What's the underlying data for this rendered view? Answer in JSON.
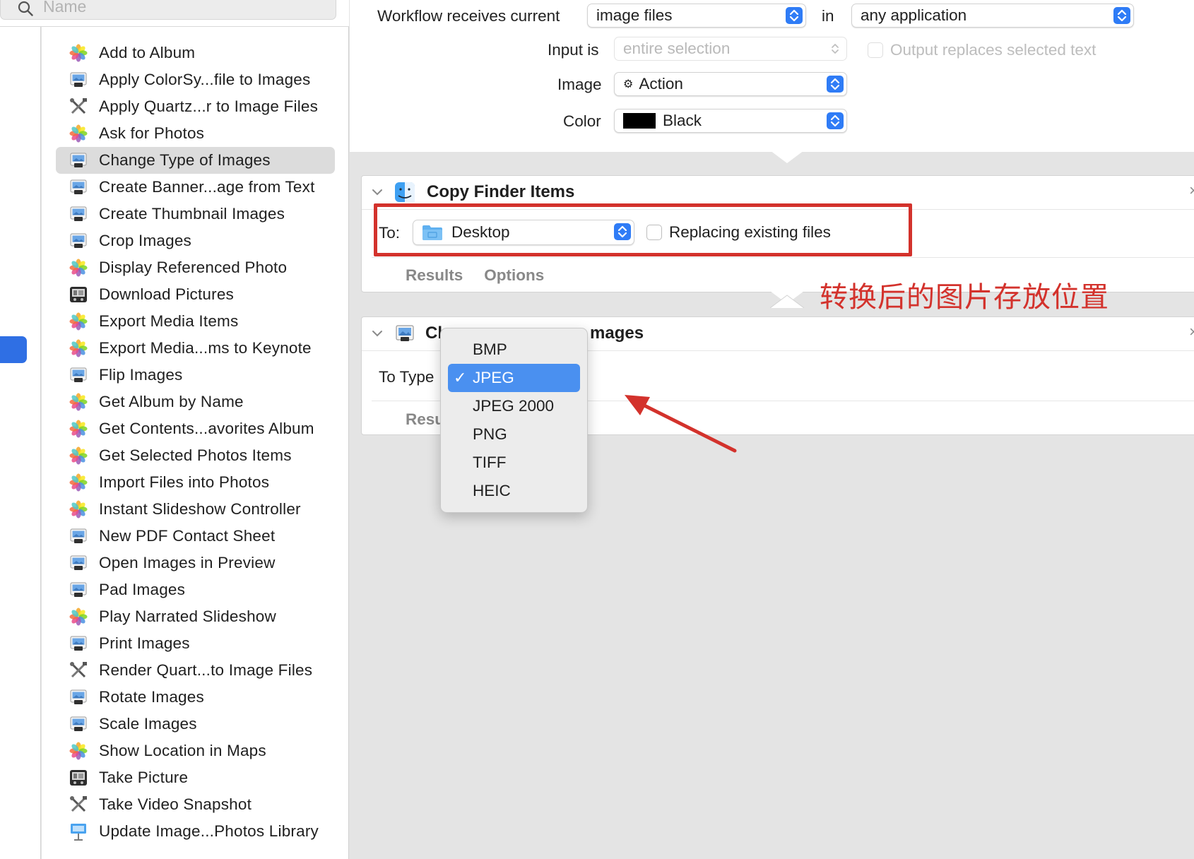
{
  "search": {
    "placeholder": "Name"
  },
  "library": {
    "items": [
      {
        "label": "Add to Album",
        "icon": "photos-icon"
      },
      {
        "label": "Apply ColorSy...file to Images",
        "icon": "preview-icon"
      },
      {
        "label": "Apply Quartz...r to Image Files",
        "icon": "tools-icon"
      },
      {
        "label": "Ask for Photos",
        "icon": "photos-icon"
      },
      {
        "label": "Change Type of Images",
        "icon": "preview-icon",
        "selected": true
      },
      {
        "label": "Create Banner...age from Text",
        "icon": "preview-icon"
      },
      {
        "label": "Create Thumbnail Images",
        "icon": "preview-icon"
      },
      {
        "label": "Crop Images",
        "icon": "preview-icon"
      },
      {
        "label": "Display Referenced Photo",
        "icon": "photos-icon"
      },
      {
        "label": "Download Pictures",
        "icon": "image-capture-icon"
      },
      {
        "label": "Export Media Items",
        "icon": "photos-icon"
      },
      {
        "label": "Export Media...ms to Keynote",
        "icon": "photos-icon"
      },
      {
        "label": "Flip Images",
        "icon": "preview-icon"
      },
      {
        "label": "Get Album by Name",
        "icon": "photos-icon"
      },
      {
        "label": "Get Contents...avorites Album",
        "icon": "photos-icon"
      },
      {
        "label": "Get Selected Photos Items",
        "icon": "photos-icon"
      },
      {
        "label": "Import Files into Photos",
        "icon": "photos-icon"
      },
      {
        "label": "Instant Slideshow Controller",
        "icon": "photos-icon"
      },
      {
        "label": "New PDF Contact Sheet",
        "icon": "preview-icon"
      },
      {
        "label": "Open Images in Preview",
        "icon": "preview-icon"
      },
      {
        "label": "Pad Images",
        "icon": "preview-icon"
      },
      {
        "label": "Play Narrated Slideshow",
        "icon": "photos-icon"
      },
      {
        "label": "Print Images",
        "icon": "preview-icon"
      },
      {
        "label": "Render Quart...to Image Files",
        "icon": "tools-icon"
      },
      {
        "label": "Rotate Images",
        "icon": "preview-icon"
      },
      {
        "label": "Scale Images",
        "icon": "preview-icon"
      },
      {
        "label": "Show Location in Maps",
        "icon": "photos-icon"
      },
      {
        "label": "Take Picture",
        "icon": "image-capture-icon"
      },
      {
        "label": "Take Video Snapshot",
        "icon": "tools-icon"
      },
      {
        "label": "Update Image...Photos Library",
        "icon": "keynote-icon"
      }
    ]
  },
  "workflow_settings": {
    "receives_label": "Workflow receives current",
    "receives_value": "image files",
    "in_label": "in",
    "application_value": "any application",
    "input_label": "Input is",
    "input_value": "entire selection",
    "output_replaces_label": "Output replaces selected text",
    "image_label": "Image",
    "image_value": "Action",
    "color_label": "Color",
    "color_value": "Black",
    "color_swatch": "#000000"
  },
  "copy_finder": {
    "title": "Copy Finder Items",
    "to_label": "To:",
    "destination": "Desktop",
    "replacing_label": "Replacing existing files",
    "tabs": [
      "Results",
      "Options"
    ]
  },
  "change_type": {
    "title_start": "Ch",
    "title_end": "mages",
    "to_type_label": "To Type",
    "results_partial": "Resu"
  },
  "type_menu": {
    "check_mark": "✓",
    "options": [
      "BMP",
      "JPEG",
      "JPEG 2000",
      "PNG",
      "TIFF",
      "HEIC"
    ],
    "selected": "JPEG"
  },
  "annotation": {
    "text": "转换后的图片存放位置",
    "color": "#d3322c"
  },
  "colors": {
    "accent": "#2f7cf6",
    "menu_highlight": "#4a90f0",
    "selection_bg": "#dcdcdc"
  }
}
